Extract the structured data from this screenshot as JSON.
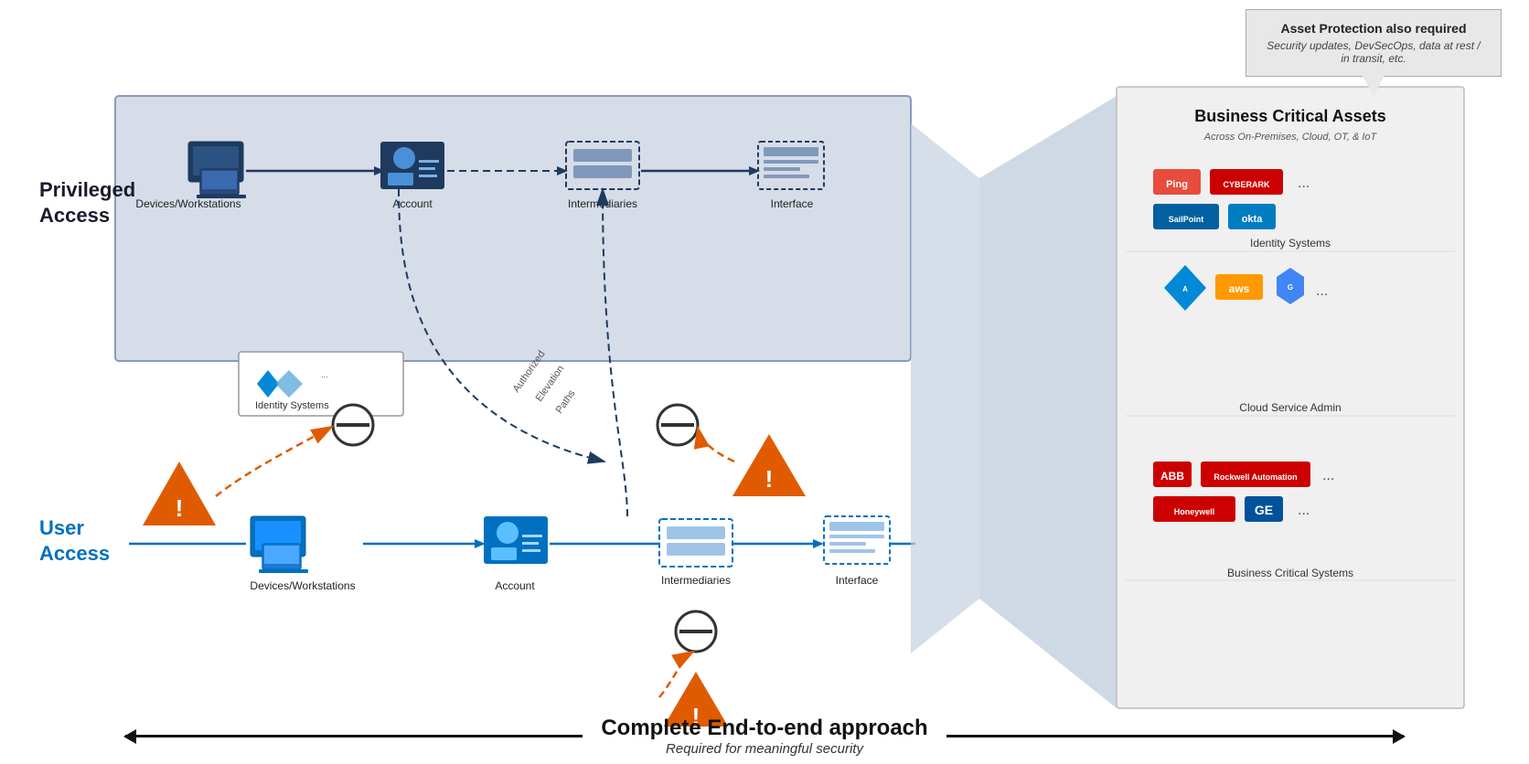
{
  "callout": {
    "title": "Asset Protection also required",
    "subtitle": "Security updates, DevSecOps, data at rest / in transit, etc."
  },
  "labels": {
    "privileged_access": "Privileged Access",
    "user_access": "User Access"
  },
  "bca": {
    "title": "Business Critical Assets",
    "subtitle": "Across On-Premises, Cloud, OT, & IoT",
    "sections": [
      {
        "name": "Identity Systems",
        "logos": [
          "Ping",
          "CYBERARK",
          "SailPoint",
          "okta",
          "..."
        ]
      },
      {
        "name": "Cloud Service Admin",
        "logos": [
          "azure",
          "aws",
          "GCP",
          "..."
        ]
      },
      {
        "name": "Business Critical Systems",
        "logos": [
          "ABB",
          "Rockwell Automation",
          "Honeywell",
          "GE",
          "..."
        ]
      }
    ]
  },
  "nodes": {
    "priv_devices": "Devices/Workstations",
    "priv_account": "Account",
    "priv_intermediaries": "Intermediaries",
    "priv_interface": "Interface",
    "user_devices": "Devices/Workstations",
    "user_account": "Account",
    "user_intermediaries": "Intermediaries",
    "user_interface": "Interface",
    "identity_systems": "Identity Systems",
    "authorized_elevation": "Authorized\nElevation\nPaths"
  },
  "bottom": {
    "title": "Complete End-to-end approach",
    "subtitle": "Required for meaningful security"
  }
}
